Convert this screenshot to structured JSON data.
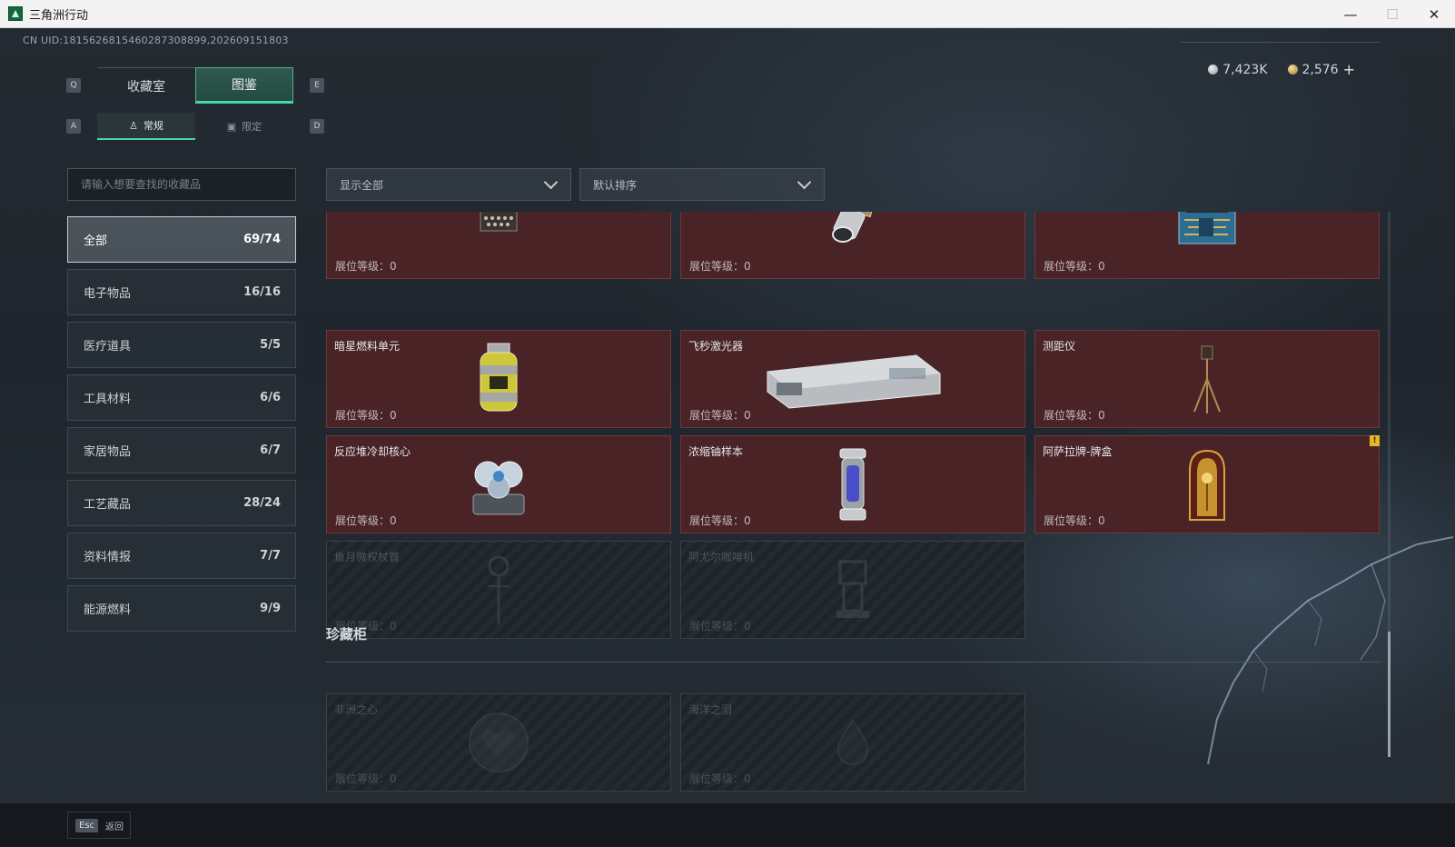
{
  "window": {
    "title": "三角洲行动",
    "minimize": "—",
    "maximize": "☐",
    "close": "✕"
  },
  "uid": "CN UID:1815626815460287308899,202609151803",
  "currency": {
    "silver": "7,423K",
    "gold": "2,576",
    "add": "+"
  },
  "tabs": {
    "prev_key": "Q",
    "next_key": "E",
    "items": [
      {
        "label": "收藏室"
      },
      {
        "label": "图鉴",
        "active": true
      }
    ]
  },
  "subtabs": {
    "prev_key": "A",
    "next_key": "D",
    "items": [
      {
        "label": "常规",
        "icon": "figure-icon",
        "active": true
      },
      {
        "label": "限定",
        "icon": "image-icon"
      }
    ]
  },
  "search": {
    "placeholder": "请输入想要查找的收藏品"
  },
  "filters": {
    "show": "显示全部",
    "sort": "默认排序"
  },
  "categories": [
    {
      "label": "全部",
      "count": "69/74",
      "active": true
    },
    {
      "label": "电子物品",
      "count": "16/16"
    },
    {
      "label": "医疗道具",
      "count": "5/5"
    },
    {
      "label": "工具材料",
      "count": "6/6"
    },
    {
      "label": "家居物品",
      "count": "6/7"
    },
    {
      "label": "工艺藏品",
      "count": "28/24"
    },
    {
      "label": "资料情报",
      "count": "7/7"
    },
    {
      "label": "能源燃料",
      "count": "9/9"
    }
  ],
  "level_label": "展位等级：",
  "cards": [
    {
      "name": "",
      "level": "0",
      "icon": "typewriter-icon"
    },
    {
      "name": "",
      "level": "0",
      "icon": "lens-device-icon"
    },
    {
      "name": "",
      "level": "0",
      "icon": "circuit-machine-icon"
    },
    {
      "name": "暗星燃料单元",
      "level": "0",
      "icon": "fuel-canister-icon"
    },
    {
      "name": "飞秒激光器",
      "level": "0",
      "icon": "laser-case-icon"
    },
    {
      "name": "测距仪",
      "level": "0",
      "icon": "tripod-icon"
    },
    {
      "name": "反应堆冷却核心",
      "level": "0",
      "icon": "reactor-core-icon"
    },
    {
      "name": "浓缩铀样本",
      "level": "0",
      "icon": "uranium-capsule-icon"
    },
    {
      "name": "阿萨拉牌-牌盒",
      "level": "0",
      "icon": "card-box-icon",
      "badge": "!"
    },
    {
      "name": "鱼月微权杖首",
      "level": "0",
      "icon": "scepter-icon",
      "locked": true
    },
    {
      "name": "阿尤尔咖啡机",
      "level": "0",
      "icon": "coffee-machine-icon",
      "locked": true
    }
  ],
  "cabinet": {
    "title": "珍藏柜",
    "cards": [
      {
        "name": "非洲之心",
        "level": "0",
        "icon": "gem-heart-icon",
        "locked": true
      },
      {
        "name": "海洋之泪",
        "level": "0",
        "icon": "gem-tear-icon",
        "locked": true
      }
    ]
  },
  "footer": {
    "esc_key": "Esc",
    "back_label": "返回"
  }
}
